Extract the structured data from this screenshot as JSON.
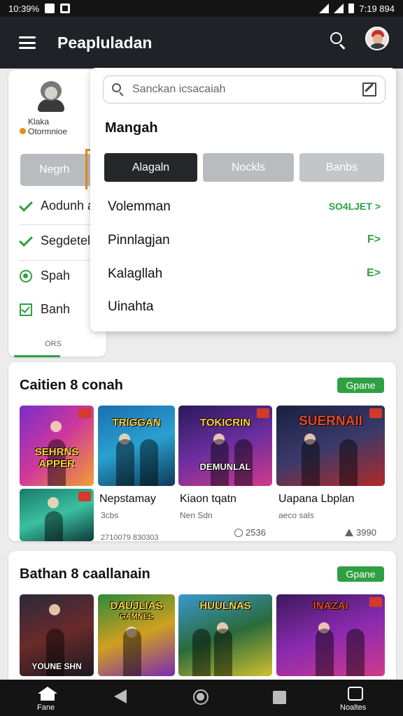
{
  "status_bar": {
    "left_text": "10:39%",
    "right_text": "7:19 894"
  },
  "app_bar": {
    "title": "Peapluladan"
  },
  "background_panel": {
    "brand_line1": "Klaka",
    "brand_line2": "Otormnioe",
    "nav_button": "Negrh",
    "items": [
      {
        "label": "Aodunh a",
        "icon": "check-icon"
      },
      {
        "label": "Segdetel",
        "icon": "check-icon"
      },
      {
        "label": "Spah",
        "icon": "radio-icon"
      },
      {
        "label": "Banh",
        "icon": "checkbox-icon"
      }
    ],
    "footer": "ORS"
  },
  "dropdown": {
    "search_placeholder": "Sanckan icsacaiah",
    "heading": "Mangah",
    "segments": [
      {
        "label": "Alagaln",
        "active": true
      },
      {
        "label": "Nockls",
        "active": false
      },
      {
        "label": "Banbs",
        "active": false
      }
    ],
    "rows": [
      {
        "label": "Volemman",
        "trailing": "SO4LJET >"
      },
      {
        "label": "Pinnlagjan",
        "trailing": "F>"
      },
      {
        "label": "Kalagllah",
        "trailing": "E>"
      },
      {
        "label": "Uinahta",
        "trailing": ""
      }
    ]
  },
  "section1": {
    "title": "Caitien 8 conah",
    "pill": "Gpane",
    "thumb_titles": [
      "SEHRNS APPER",
      "TRIGGAN",
      "TOKICRIN",
      "SUERNAII"
    ],
    "thumb_subtitles": [
      "",
      "",
      "DEMUNLAL",
      ""
    ],
    "games": [
      {
        "name": "Nepstamay",
        "sub": "3cbs"
      },
      {
        "name": "Kiaon tqatn",
        "sub": "Nen Sdn",
        "stat": "2536"
      },
      {
        "name": "Uapana Lbplan",
        "sub": "aeco sals",
        "stat": "3990"
      }
    ],
    "footer_text": "2710079 830303"
  },
  "section2": {
    "title": "Bathan 8 caallanain",
    "pill": "Gpane",
    "thumb_titles": [
      "",
      "DAUJLIAS",
      "HUULNAS",
      "INAZAI"
    ],
    "thumb_subtitles": [
      "YOUNE SHN",
      "GAMNES",
      "",
      ""
    ]
  },
  "bottom_nav": {
    "home_label": "Fane",
    "account_label": "Noaltes"
  },
  "colors": {
    "accent_green": "#2ea043",
    "app_bar": "#1f2226",
    "orange": "#e88a1e",
    "dark_segment": "#25272b"
  }
}
